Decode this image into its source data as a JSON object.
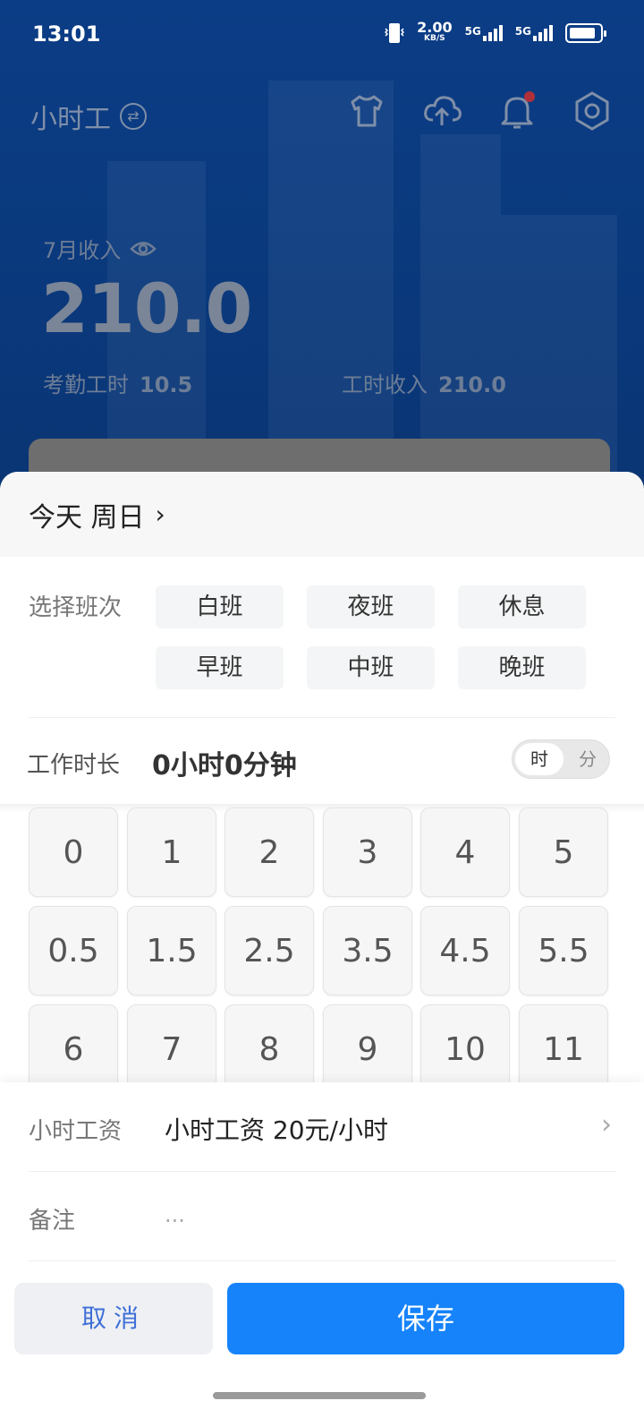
{
  "status_bar": {
    "time": "13:01",
    "net_speed_value": "2.00",
    "net_speed_unit": "KB/S",
    "sim1": "5G",
    "sim2": "5G"
  },
  "header": {
    "title": "小时工",
    "icons": [
      "shirt-icon",
      "cloud-upload-icon",
      "bell-icon",
      "settings-hex-icon"
    ]
  },
  "summary": {
    "month_label": "7月收入",
    "income": "210.0",
    "attendance_label": "考勤工时",
    "attendance_value": "10.5",
    "hour_income_label": "工时收入",
    "hour_income_value": "210.0"
  },
  "sheet": {
    "date": "今天 周日",
    "shift_label": "选择班次",
    "shifts": [
      "白班",
      "夜班",
      "休息",
      "早班",
      "中班",
      "晚班"
    ],
    "duration_label": "工作时长",
    "duration_value": "0小时0分钟",
    "unit_hour": "时",
    "unit_minute": "分",
    "keys": [
      "0",
      "1",
      "2",
      "3",
      "4",
      "5",
      "0.5",
      "1.5",
      "2.5",
      "3.5",
      "4.5",
      "5.5",
      "6",
      "7",
      "8",
      "9",
      "10",
      "11"
    ],
    "wage_label": "小时工资",
    "wage_value": "小时工资 20元/小时",
    "note_label": "备注",
    "note_placeholder": "...",
    "cancel_label": "取消",
    "save_label": "保存"
  },
  "colors": {
    "hero_bg": "#0b3d86",
    "primary": "#1683fb",
    "cancel_text": "#3f6fd8",
    "bell_badge": "#b0303a"
  }
}
